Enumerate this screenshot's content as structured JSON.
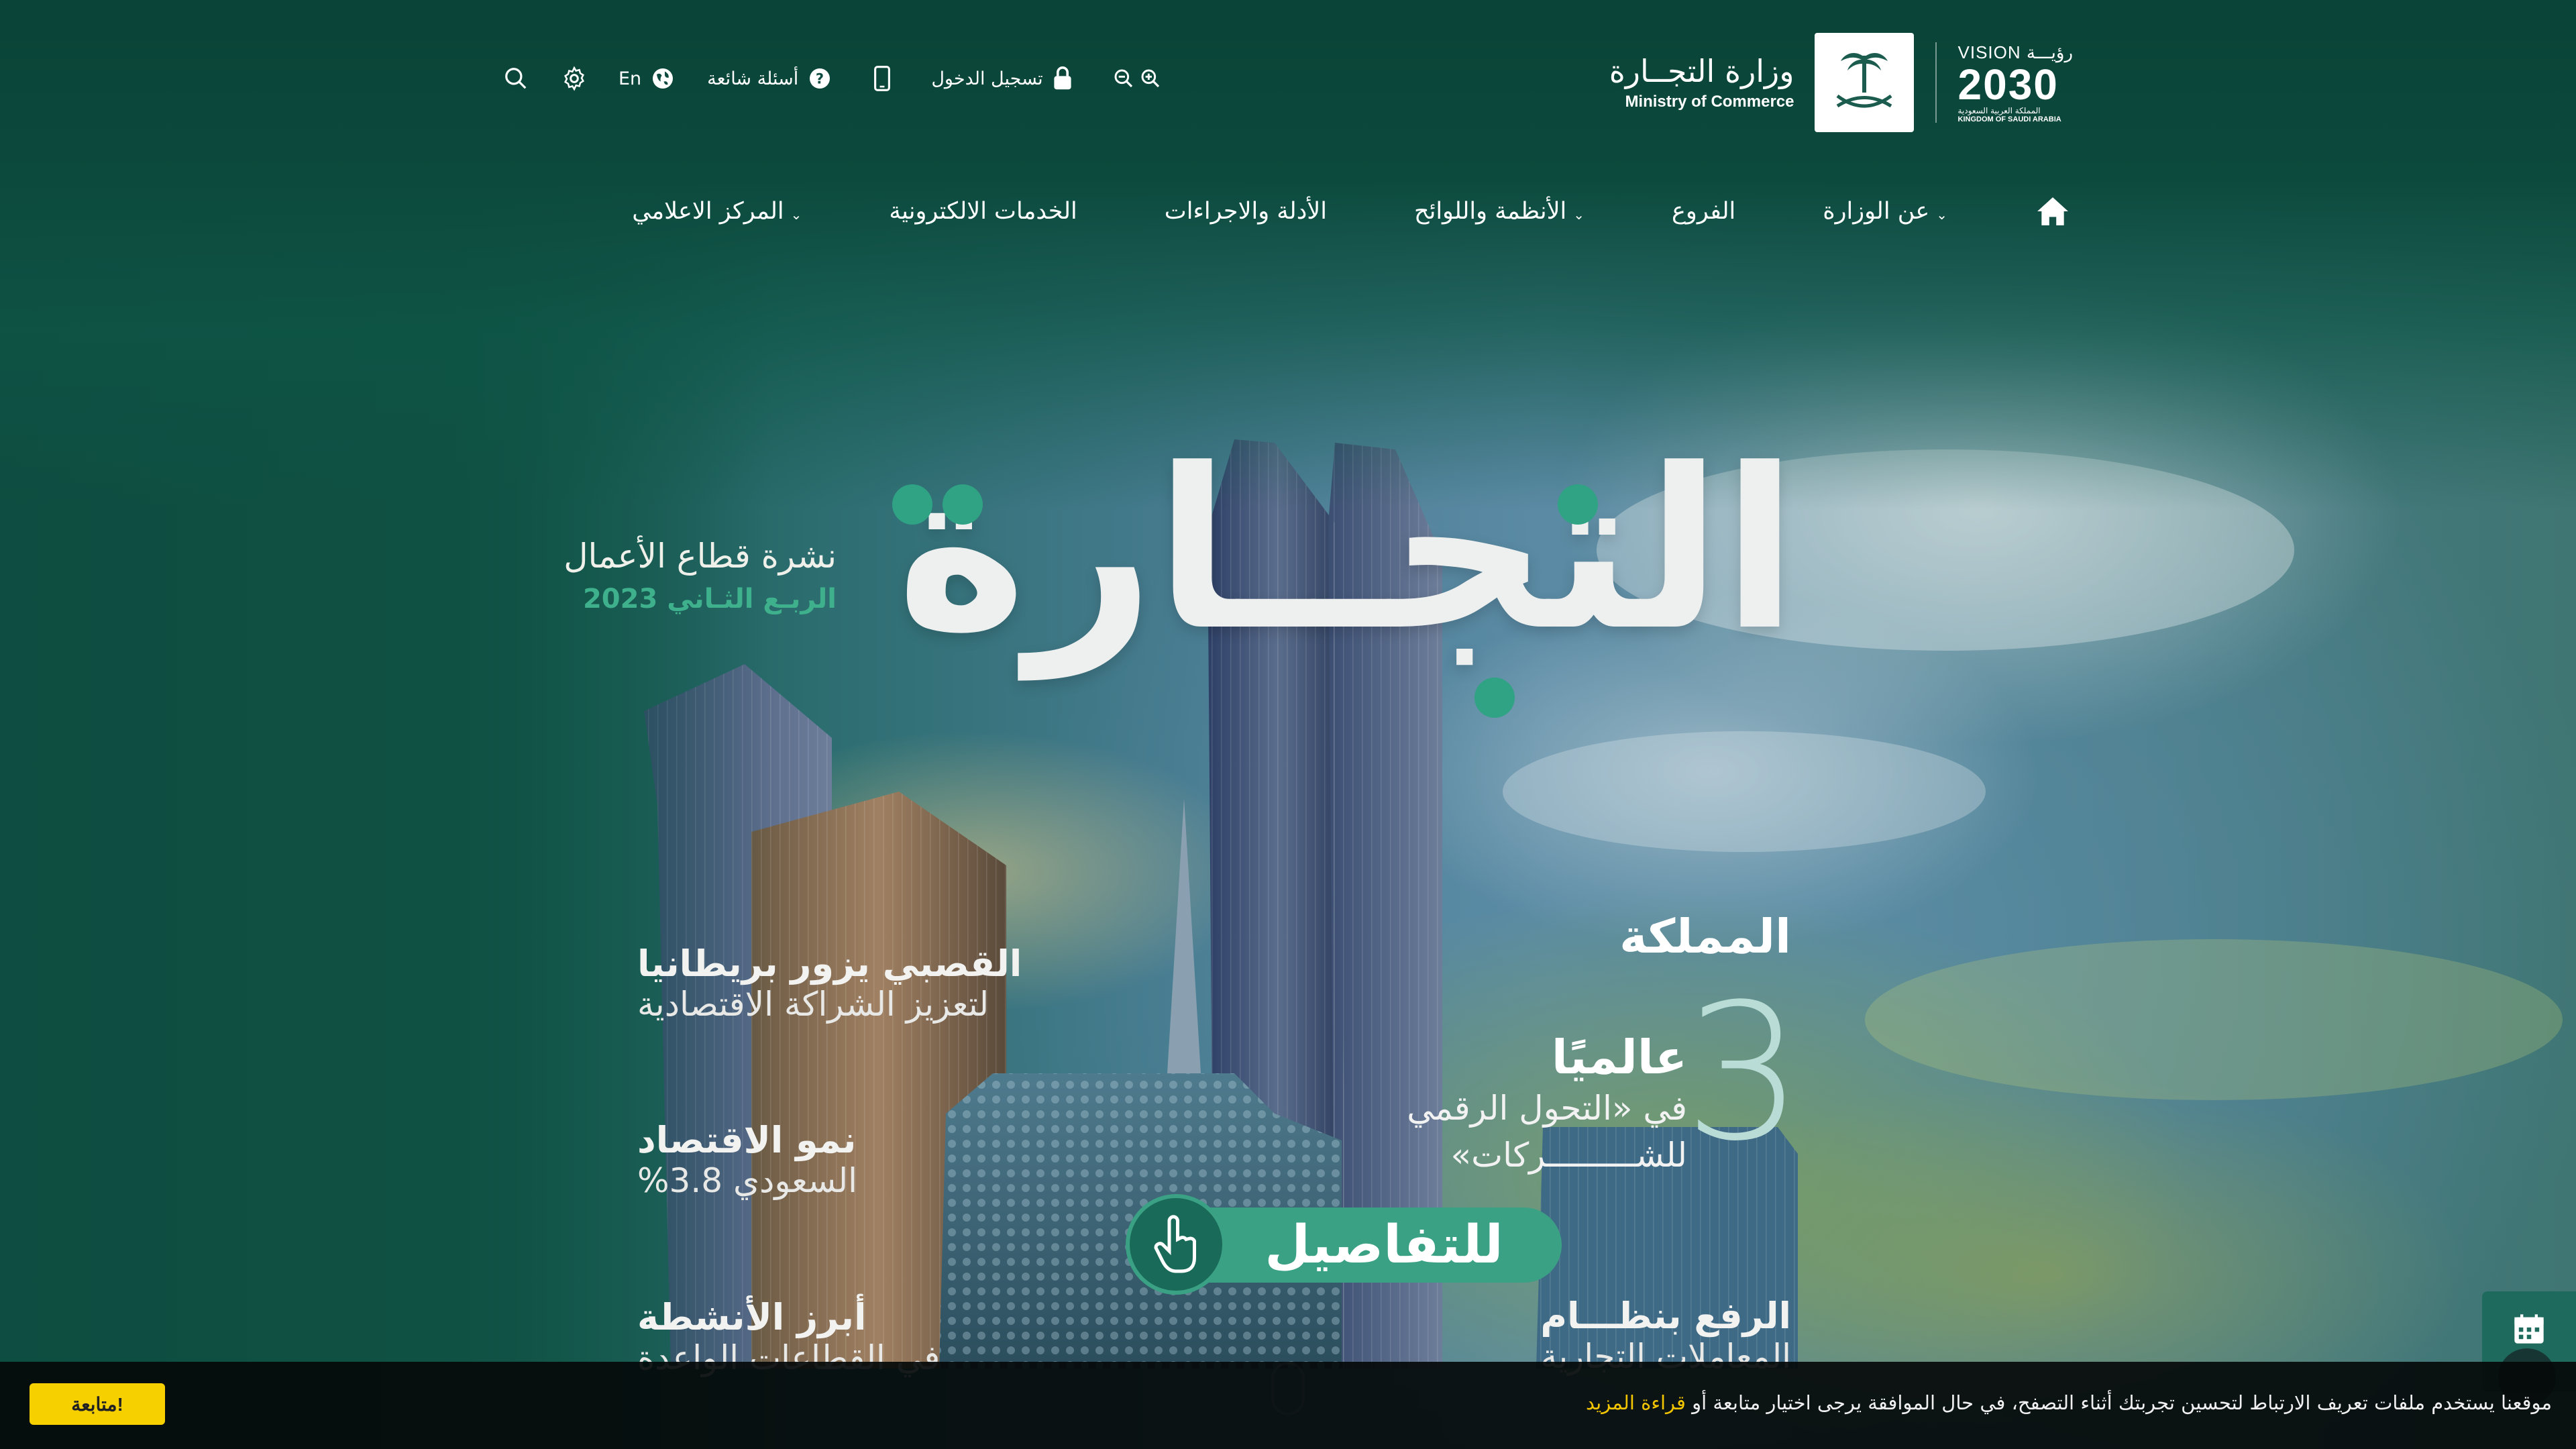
{
  "colors": {
    "primary_green": "#0d4a40",
    "accent_green": "#3aa184",
    "cookie_button": "#f7d000",
    "cookie_link": "#f3c500"
  },
  "header": {
    "ministry_ar": "وزارة التجــارة",
    "ministry_en": "Ministry of Commerce",
    "vision_title": "VISION رؤيـــة",
    "vision_year": "2030",
    "vision_sub_ar": "المملكة العربية السعودية",
    "vision_sub_en": "KINGDOM OF SAUDI ARABIA"
  },
  "utility": {
    "login": "تسجيل الدخول",
    "faq": "أسئلة شائعة",
    "lang": "En",
    "icons": [
      "zoom-in-icon",
      "zoom-out-icon",
      "lock-icon",
      "mobile-icon",
      "help-icon",
      "globe-icon",
      "gear-icon",
      "search-icon"
    ]
  },
  "nav": {
    "about": "عن الوزارة",
    "branches": "الفروع",
    "regulations": "الأنظمة واللوائح",
    "guides": "الأدلة والاجراءات",
    "eservices": "الخدمات الالكترونية",
    "media": "المركز الاعلامي"
  },
  "hero": {
    "main_title": "التجــارة",
    "bulletin_title": "نشرة قطاع الأعمال",
    "bulletin_quarter": "الربـع الثـاني 2023",
    "left_items": [
      {
        "title": "القصبي يزور بريطانيا",
        "subtitle": "لتعزيز الشراكة الاقتصادية"
      },
      {
        "title": "نمو الاقتصاد",
        "subtitle": "السعودي 3.8%"
      },
      {
        "title": "أبرز الأنشطة",
        "subtitle": "في القطاعات الواعدة"
      }
    ],
    "right_kingdom": "المملكة",
    "right_rank_number": "3",
    "right_globally": "عالميًا",
    "right_line1": "في «التحول الرقمي",
    "right_line2": "للشـــــــــركات»",
    "right_bottom_title": "الرفع بنظـــام",
    "right_bottom_sub": "المعاملات التجارية",
    "details_button": "للتفاصيل"
  },
  "cookie": {
    "message": "موقعنا يستخدم ملفات تعريف الارتباط لتحسين تجربتك أثناء التصفح، في حال الموافقة يرجى اختيار متابعة أو ",
    "read_more": "قراءة المزيد",
    "button": "متابعة!"
  }
}
